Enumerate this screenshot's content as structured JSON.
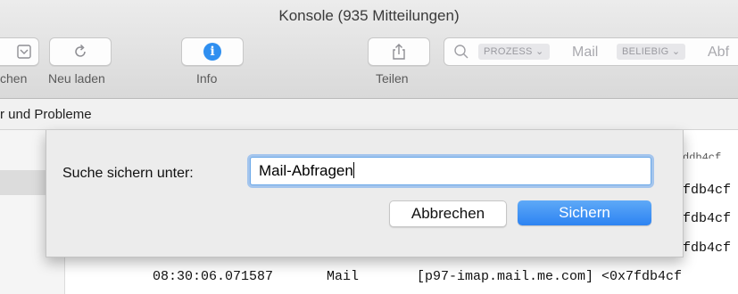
{
  "window": {
    "title": "Konsole (935 Mitteilungen)"
  },
  "toolbar": {
    "partial_label": "chen",
    "reload_label": "Neu laden",
    "info_label": "Info",
    "info_glyph": "i",
    "share_label": "Teilen"
  },
  "search": {
    "token1": "PROZESS",
    "token1_value": "Mail",
    "token2": "BELIEBIG",
    "token2_value": "Abf"
  },
  "filterbar": {
    "label": "r und Probleme"
  },
  "log": {
    "rows": [
      {
        "suffix": "fdb4cf"
      },
      {
        "suffix": "fdb4cf"
      },
      {
        "suffix": "fdb4cf"
      }
    ],
    "full_row": {
      "time": "08:30:06.071587",
      "process": "Mail",
      "message": "[p97-imap.mail.me.com] <0x7fdb4cf"
    }
  },
  "dialog": {
    "label": "Suche sichern unter:",
    "input_value": "Mail-Abfragen",
    "cancel_label": "Abbrechen",
    "save_label": "Sichern"
  },
  "colors": {
    "accent": "#2f8ff0",
    "save_button": "#3b8ff4"
  }
}
